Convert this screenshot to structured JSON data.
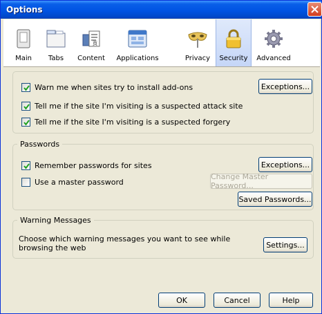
{
  "window": {
    "title": "Options"
  },
  "toolbar": {
    "tabs": [
      {
        "label": "Main",
        "icon": "switch-icon"
      },
      {
        "label": "Tabs",
        "icon": "tabs-icon"
      },
      {
        "label": "Content",
        "icon": "content-icon"
      },
      {
        "label": "Applications",
        "icon": "applications-icon"
      },
      {
        "label": "Privacy",
        "icon": "privacy-mask-icon"
      },
      {
        "label": "Security",
        "icon": "padlock-icon",
        "selected": true
      },
      {
        "label": "Advanced",
        "icon": "gear-icon"
      }
    ]
  },
  "security": {
    "addons_warning": {
      "label": "Warn me when sites try to install add-ons",
      "checked": true
    },
    "addons_exceptions_label": "Exceptions...",
    "attack_site": {
      "label": "Tell me if the site I'm visiting is a suspected attack site",
      "checked": true
    },
    "forgery": {
      "label": "Tell me if the site I'm visiting is a suspected forgery",
      "checked": true
    }
  },
  "passwords": {
    "legend": "Passwords",
    "remember": {
      "label": "Remember passwords for sites",
      "checked": true
    },
    "exceptions_label": "Exceptions...",
    "master": {
      "label": "Use a master password",
      "checked": false
    },
    "change_master_label": "Change Master Password...",
    "saved_label": "Saved Passwords..."
  },
  "warnings": {
    "legend": "Warning Messages",
    "description": "Choose which warning messages you want to see while browsing the web",
    "settings_label": "Settings..."
  },
  "footer": {
    "ok": "OK",
    "cancel": "Cancel",
    "help": "Help"
  },
  "colors": {
    "titlebar": "#0054e3",
    "dialog_bg": "#ece9d8",
    "selected_tab": "#c5d6f7",
    "close_button": "#d23c1c"
  }
}
